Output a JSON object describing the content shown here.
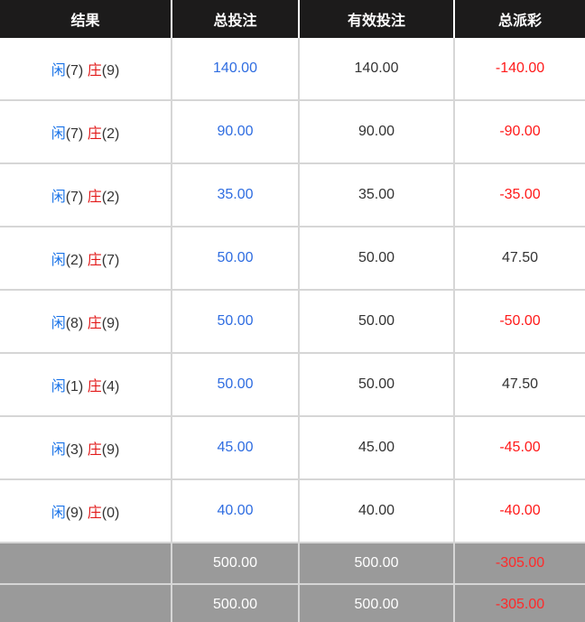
{
  "header": {
    "col_result": "结果",
    "col_total_bet": "总投注",
    "col_valid_bet": "有效投注",
    "col_payout": "总派彩"
  },
  "rows": [
    {
      "player_label": "闲",
      "player_score": "(7)",
      "banker_label": "庄",
      "banker_score": "(9)",
      "total_bet": "140.00",
      "valid_bet": "140.00",
      "payout": "-140.00"
    },
    {
      "player_label": "闲",
      "player_score": "(7)",
      "banker_label": "庄",
      "banker_score": "(2)",
      "total_bet": "90.00",
      "valid_bet": "90.00",
      "payout": "-90.00"
    },
    {
      "player_label": "闲",
      "player_score": "(7)",
      "banker_label": "庄",
      "banker_score": "(2)",
      "total_bet": "35.00",
      "valid_bet": "35.00",
      "payout": "-35.00"
    },
    {
      "player_label": "闲",
      "player_score": "(2)",
      "banker_label": "庄",
      "banker_score": "(7)",
      "total_bet": "50.00",
      "valid_bet": "50.00",
      "payout": "47.50"
    },
    {
      "player_label": "闲",
      "player_score": "(8)",
      "banker_label": "庄",
      "banker_score": "(9)",
      "total_bet": "50.00",
      "valid_bet": "50.00",
      "payout": "-50.00"
    },
    {
      "player_label": "闲",
      "player_score": "(1)",
      "banker_label": "庄",
      "banker_score": "(4)",
      "total_bet": "50.00",
      "valid_bet": "50.00",
      "payout": "47.50"
    },
    {
      "player_label": "闲",
      "player_score": "(3)",
      "banker_label": "庄",
      "banker_score": "(9)",
      "total_bet": "45.00",
      "valid_bet": "45.00",
      "payout": "-45.00"
    },
    {
      "player_label": "闲",
      "player_score": "(9)",
      "banker_label": "庄",
      "banker_score": "(0)",
      "total_bet": "40.00",
      "valid_bet": "40.00",
      "payout": "-40.00"
    }
  ],
  "subtotal": {
    "total_bet": "500.00",
    "valid_bet": "500.00",
    "payout": "-305.00"
  },
  "total": {
    "total_bet": "500.00",
    "valid_bet": "500.00",
    "payout": "-305.00"
  },
  "colors": {
    "header_bg": "#1c1b1b",
    "footer_bg": "#9a9a9a",
    "player_blue": "#1a73e8",
    "banker_red": "#e21b1b",
    "bet_blue": "#2f6de1",
    "loss_red": "#ff1a1a"
  }
}
